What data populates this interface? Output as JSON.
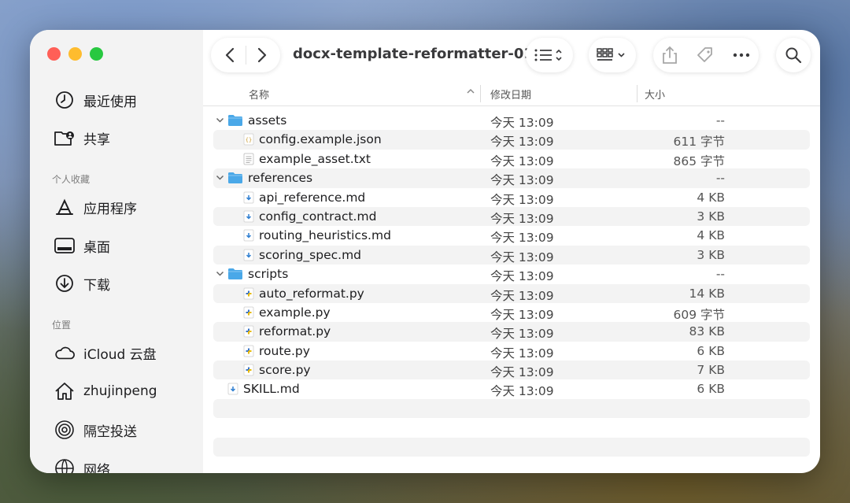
{
  "window": {
    "title": "docx-template-reformatter-01..."
  },
  "sidebar": {
    "items_top": [
      {
        "label": "最近使用",
        "icon": "clock-icon"
      },
      {
        "label": "共享",
        "icon": "shared-folder-icon"
      }
    ],
    "section_favorites": "个人收藏",
    "favorites": [
      {
        "label": "应用程序",
        "icon": "applications-icon"
      },
      {
        "label": "桌面",
        "icon": "desktop-icon"
      },
      {
        "label": "下载",
        "icon": "download-icon"
      }
    ],
    "section_locations": "位置",
    "locations": [
      {
        "label": "iCloud 云盘",
        "icon": "cloud-icon"
      },
      {
        "label": "zhujinpeng",
        "icon": "home-icon"
      },
      {
        "label": "隔空投送",
        "icon": "airdrop-icon"
      },
      {
        "label": "网络",
        "icon": "network-icon"
      }
    ]
  },
  "columns": {
    "name": "名称",
    "modified": "修改日期",
    "size": "大小"
  },
  "files": [
    {
      "name": "assets",
      "type": "folder",
      "level": 0,
      "date": "今天 13:09",
      "size": "--"
    },
    {
      "name": "config.example.json",
      "type": "json",
      "level": 1,
      "date": "今天 13:09",
      "size": "611 字节"
    },
    {
      "name": "example_asset.txt",
      "type": "txt",
      "level": 1,
      "date": "今天 13:09",
      "size": "865 字节"
    },
    {
      "name": "references",
      "type": "folder",
      "level": 0,
      "date": "今天 13:09",
      "size": "--"
    },
    {
      "name": "api_reference.md",
      "type": "md",
      "level": 1,
      "date": "今天 13:09",
      "size": "4 KB"
    },
    {
      "name": "config_contract.md",
      "type": "md",
      "level": 1,
      "date": "今天 13:09",
      "size": "3 KB"
    },
    {
      "name": "routing_heuristics.md",
      "type": "md",
      "level": 1,
      "date": "今天 13:09",
      "size": "4 KB"
    },
    {
      "name": "scoring_spec.md",
      "type": "md",
      "level": 1,
      "date": "今天 13:09",
      "size": "3 KB"
    },
    {
      "name": "scripts",
      "type": "folder",
      "level": 0,
      "date": "今天 13:09",
      "size": "--"
    },
    {
      "name": "auto_reformat.py",
      "type": "py",
      "level": 1,
      "date": "今天 13:09",
      "size": "14 KB"
    },
    {
      "name": "example.py",
      "type": "py",
      "level": 1,
      "date": "今天 13:09",
      "size": "609 字节"
    },
    {
      "name": "reformat.py",
      "type": "py",
      "level": 1,
      "date": "今天 13:09",
      "size": "83 KB"
    },
    {
      "name": "route.py",
      "type": "py",
      "level": 1,
      "date": "今天 13:09",
      "size": "6 KB"
    },
    {
      "name": "score.py",
      "type": "py",
      "level": 1,
      "date": "今天 13:09",
      "size": "7 KB"
    },
    {
      "name": "SKILL.md",
      "type": "md",
      "level": 0,
      "date": "今天 13:09",
      "size": "6 KB"
    }
  ],
  "colors": {
    "folder": "#4aa8e8",
    "accent": "#2f7fd1"
  }
}
